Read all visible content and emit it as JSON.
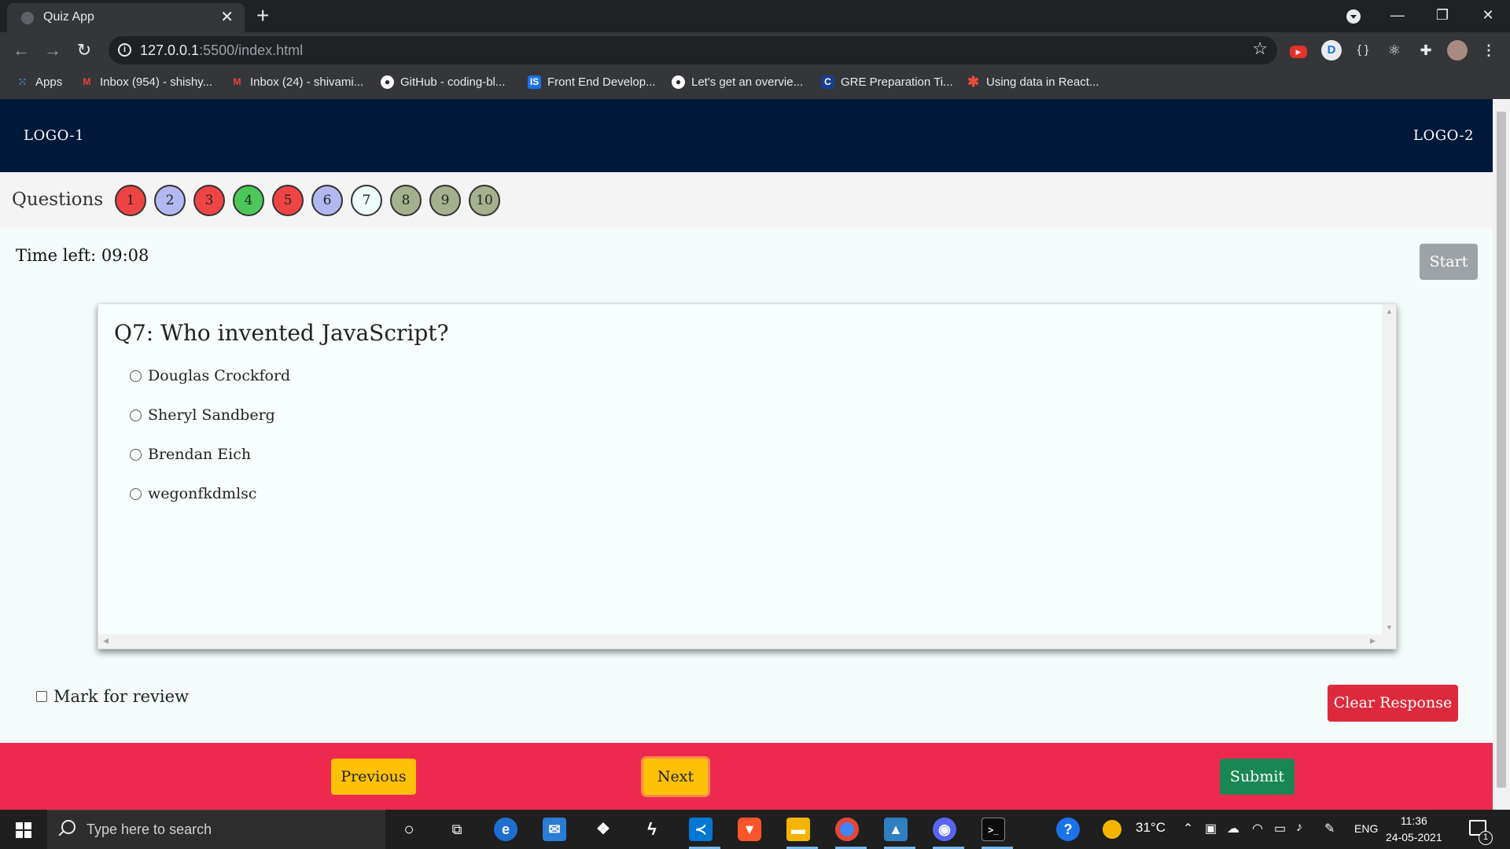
{
  "browser": {
    "tab_title": "Quiz App",
    "url_host": "127.0.0.1",
    "url_path": ":5500/index.html",
    "bookmarks": [
      {
        "label": "Apps",
        "icon": "apps-grid-icon",
        "color": "#ea4335"
      },
      {
        "label": "Inbox (954) - shishy...",
        "icon": "gmail-icon",
        "color": "#ea4335"
      },
      {
        "label": "Inbox (24) - shivami...",
        "icon": "gmail-icon",
        "color": "#ea4335"
      },
      {
        "label": "GitHub - coding-bl...",
        "icon": "github-icon",
        "color": "#ffffff"
      },
      {
        "label": "Front End Develop...",
        "icon": "is-icon",
        "color": "#1a73e8"
      },
      {
        "label": "Let's get an overvie...",
        "icon": "github-icon",
        "color": "#ffffff"
      },
      {
        "label": "GRE Preparation Ti...",
        "icon": "c-icon",
        "color": "#1a3f8f"
      },
      {
        "label": "Using data in React...",
        "icon": "asterisk-icon",
        "color": "#e94e3c"
      }
    ]
  },
  "app": {
    "logo_left": "LOGO-1",
    "logo_right": "LOGO-2",
    "questions_label": "Questions",
    "question_numbers": [
      {
        "n": "1",
        "color": "#ef4444"
      },
      {
        "n": "2",
        "color": "#b3b8f0"
      },
      {
        "n": "3",
        "color": "#ef4444"
      },
      {
        "n": "4",
        "color": "#4cc85a"
      },
      {
        "n": "5",
        "color": "#ef4444"
      },
      {
        "n": "6",
        "color": "#b3b8f0"
      },
      {
        "n": "7",
        "color": "#eefcfc"
      },
      {
        "n": "8",
        "color": "#a5b08e"
      },
      {
        "n": "9",
        "color": "#a5b08e"
      },
      {
        "n": "10",
        "color": "#a5b08e"
      }
    ],
    "timer": "Time left: 09:08",
    "start_label": "Start",
    "question": "Q7: Who invented JavaScript?",
    "options": [
      "Douglas Crockford",
      "Sheryl Sandberg",
      "Brendan Eich",
      "wegonfkdmlsc"
    ],
    "mark_review_label": "Mark for review",
    "clear_label": "Clear Response",
    "previous_label": "Previous",
    "next_label": "Next",
    "submit_label": "Submit"
  },
  "taskbar": {
    "search_placeholder": "Type here to search",
    "weather": "31°C",
    "language": "ENG",
    "time": "11:36",
    "date": "24-05-2021",
    "notification_count": "1"
  }
}
